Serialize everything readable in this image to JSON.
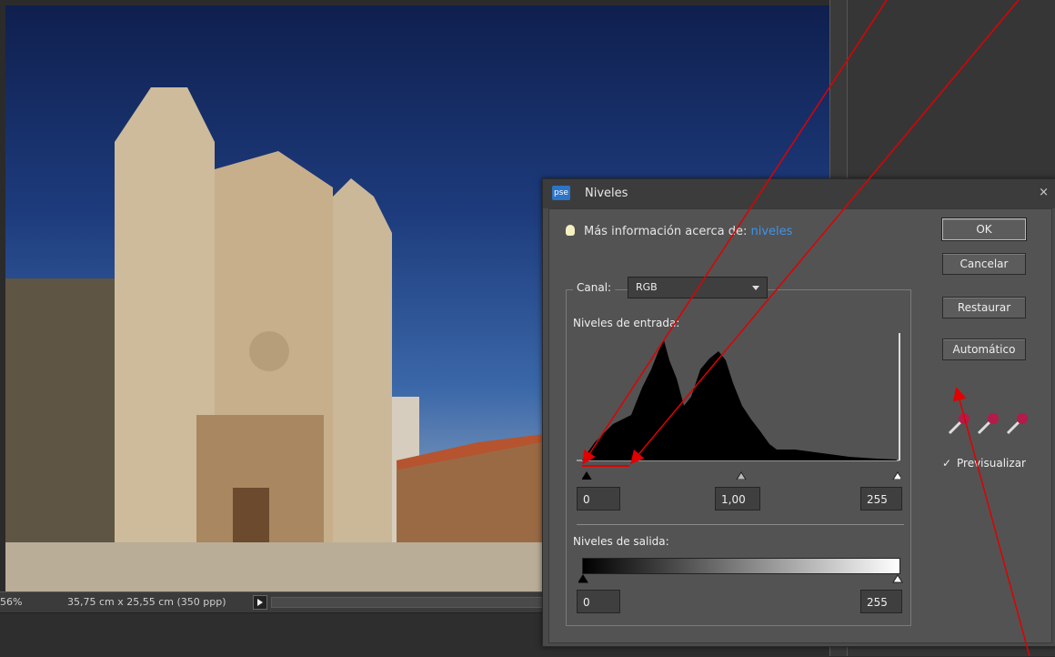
{
  "status": {
    "zoom": "56%",
    "size": "35,75 cm x 25,55 cm (350 ppp)"
  },
  "dialog": {
    "badge": "pse",
    "title": "Niveles",
    "close": "×",
    "help_prefix": "Más información acerca de:",
    "help_link": "niveles",
    "canal_label": "Canal:",
    "canal_value": "RGB",
    "input_label": "Niveles de entrada:",
    "output_label": "Niveles de salida:",
    "input_black": "0",
    "input_gamma": "1,00",
    "input_white": "255",
    "output_black": "0",
    "output_white": "255",
    "buttons": {
      "ok": "OK",
      "cancel": "Cancelar",
      "reset": "Restaurar",
      "auto": "Automático"
    },
    "preview_label": "Previsualizar",
    "preview_checked": "✓"
  },
  "colors": {
    "accent_link": "#3b94f0",
    "annotation": "#e00000"
  },
  "icons": [
    "lightbulb-icon",
    "chevron-down-icon",
    "black-eyedropper-icon",
    "gray-eyedropper-icon",
    "white-eyedropper-icon",
    "close-icon"
  ]
}
